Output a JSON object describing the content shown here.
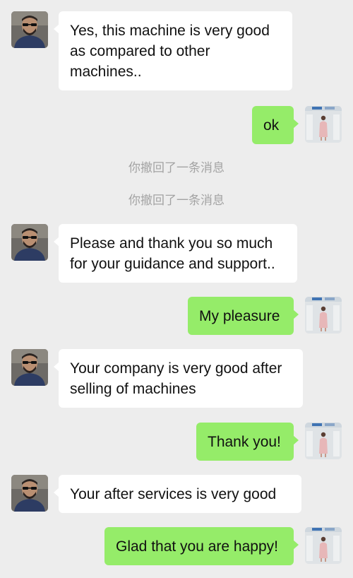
{
  "colors": {
    "background": "#ededed",
    "incoming_bubble": "#ffffff",
    "outgoing_bubble": "#95ec69",
    "system_text": "#a3a3a3"
  },
  "messages": [
    {
      "sender": "contact",
      "avatar": "man-with-sunglasses-avatar",
      "text": "Yes, this machine is very good\nas compared to other\nmachines.."
    },
    {
      "sender": "me",
      "avatar": "woman-in-office-avatar",
      "text": "ok"
    },
    {
      "system": "你撤回了一条消息"
    },
    {
      "system": "你撤回了一条消息"
    },
    {
      "sender": "contact",
      "avatar": "man-with-sunglasses-avatar",
      "text": "Please and thank you so much\nfor your guidance and support.."
    },
    {
      "sender": "me",
      "avatar": "woman-in-office-avatar",
      "text": "My pleasure"
    },
    {
      "sender": "contact",
      "avatar": "man-with-sunglasses-avatar",
      "text": "Your company is very good after\n selling of machines"
    },
    {
      "sender": "me",
      "avatar": "woman-in-office-avatar",
      "text": "Thank you!"
    },
    {
      "sender": "contact",
      "avatar": "man-with-sunglasses-avatar",
      "text": "Your after services is very good"
    },
    {
      "sender": "me",
      "avatar": "woman-in-office-avatar",
      "text": "Glad that you are happy!"
    }
  ]
}
